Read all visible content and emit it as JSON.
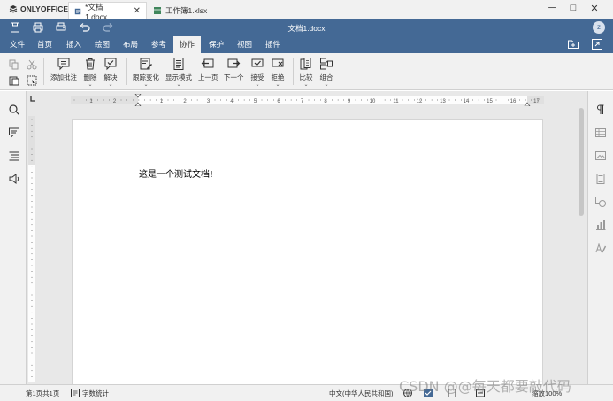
{
  "app": {
    "name": "ONLYOFFICE"
  },
  "tabs": [
    {
      "label": "*文档1.docx",
      "active": true
    },
    {
      "label": "工作簿1.xlsx",
      "active": false
    }
  ],
  "window_controls": {
    "minimize": "─",
    "maximize": "□",
    "close": "✕"
  },
  "header": {
    "doc_title": "文档1.docx",
    "avatar": "z"
  },
  "menu": [
    "文件",
    "首页",
    "插入",
    "绘图",
    "布局",
    "参考",
    "协作",
    "保护",
    "视图",
    "插件"
  ],
  "menu_active": "协作",
  "toolbar": {
    "add_comment": "添加批注",
    "delete": "删除",
    "resolve": "解决",
    "track_changes": "跟踪变化",
    "display_mode": "显示模式",
    "prev": "上一页",
    "next": "下一个",
    "accept": "接受",
    "reject": "拒绝",
    "compare": "比较",
    "combine": "组合"
  },
  "document": {
    "text": "这是一个测试文档!"
  },
  "ruler": {
    "h_ticks": [
      "1",
      "2",
      "1",
      "2",
      "3",
      "4",
      "5",
      "6",
      "7",
      "8",
      "9",
      "10",
      "11",
      "12",
      "13",
      "14",
      "15",
      "16",
      "17"
    ]
  },
  "status": {
    "page": "第1页共1页",
    "word_count": "字数统计",
    "language": "中文(中华人民共和国)",
    "zoom": "缩放100%"
  },
  "watermark": "CSDN @@每天都要敲代码",
  "colors": {
    "brand": "#446995",
    "toolbar_bg": "#f1f1f1",
    "work_bg": "#e8e8e8"
  }
}
